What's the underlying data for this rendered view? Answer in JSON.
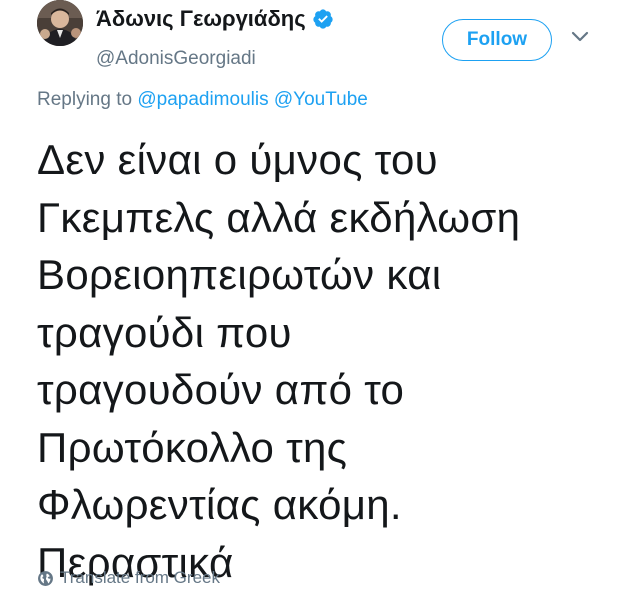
{
  "author": {
    "display_name": "Άδωνις Γεωργιάδης",
    "handle": "@AdonisGeorgiadi",
    "verified": true
  },
  "actions": {
    "follow_label": "Follow",
    "more_menu_icon": "chevron-down-icon"
  },
  "reply": {
    "prefix": "Replying to",
    "mentions": [
      "@papadimoulis",
      "@YouTube"
    ]
  },
  "tweet": {
    "lines": [
      "Δεν είναι ο ύμνος του",
      "Γκεμπελς αλλά εκδήλωση",
      "Βορειοηπειρωτών και",
      "τραγούδι που",
      "τραγουδούν από το",
      "Πρωτόκολλο της",
      "Φλωρεντίας ακόμη.",
      "Περαστικά"
    ]
  },
  "footer": {
    "translate_label": "Translate from Greek",
    "translate_icon": "globe-icon"
  },
  "colors": {
    "accent": "#1da1f2",
    "text": "#14171a",
    "secondary": "#657786"
  }
}
